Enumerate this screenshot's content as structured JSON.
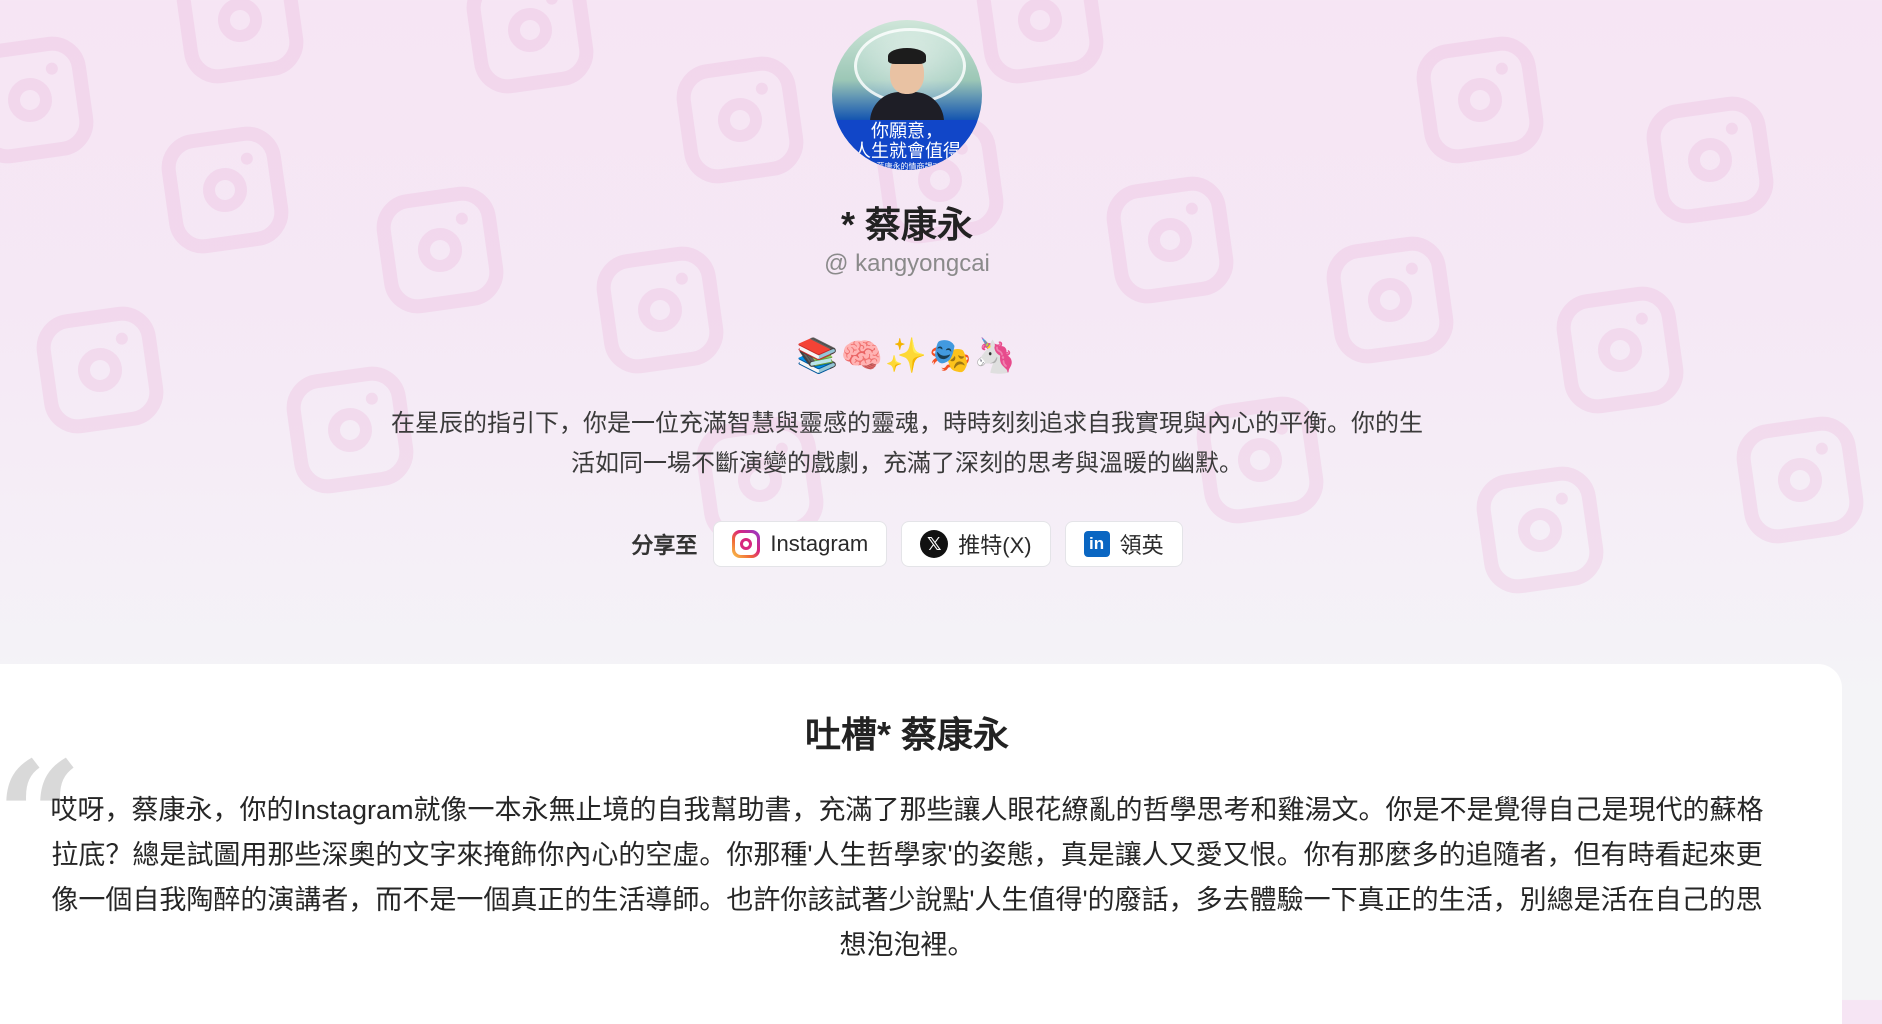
{
  "profile": {
    "avatar_caption_line1": "你願意，",
    "avatar_caption_line2": "人生就會值得",
    "avatar_caption_line3": "蔡康永的情商課3",
    "name": "* 蔡康永",
    "username": "@ kangyongcai",
    "emojis": "📚🧠✨🎭🦄",
    "bio": "在星辰的指引下，你是一位充滿智慧與靈感的靈魂，時時刻刻追求自我實現與內心的平衡。你的生活如同一場不斷演變的戲劇，充滿了深刻的思考與溫暖的幽默。"
  },
  "share": {
    "label": "分享至",
    "buttons": [
      {
        "label": "Instagram",
        "icon": "instagram-icon"
      },
      {
        "label": "推特(X)",
        "icon": "x-icon",
        "glyph": "𝕏"
      },
      {
        "label": "領英",
        "icon": "linkedin-icon",
        "glyph": "in"
      }
    ]
  },
  "roast": {
    "title": "吐槽* 蔡康永",
    "quote_glyph": "“",
    "text": "哎呀，蔡康永，你的Instagram就像一本永無止境的自我幫助書，充滿了那些讓人眼花繚亂的哲學思考和雞湯文。你是不是覺得自己是現代的蘇格拉底？總是試圖用那些深奧的文字來掩飾你內心的空虛。你那種'人生哲學家'的姿態，真是讓人又愛又恨。你有那麼多的追隨者，但有時看起來更像一個自我陶醉的演講者，而不是一個真正的生活導師。也許你該試著少說點'人生值得'的廢話，多去體驗一下真正的生活，別總是活在自己的思想泡泡裡。"
  },
  "colors": {
    "accent_pink": "#f6e5f4",
    "linkedin_blue": "#0a66c2",
    "avatar_caption_blue": "#1146c8"
  }
}
